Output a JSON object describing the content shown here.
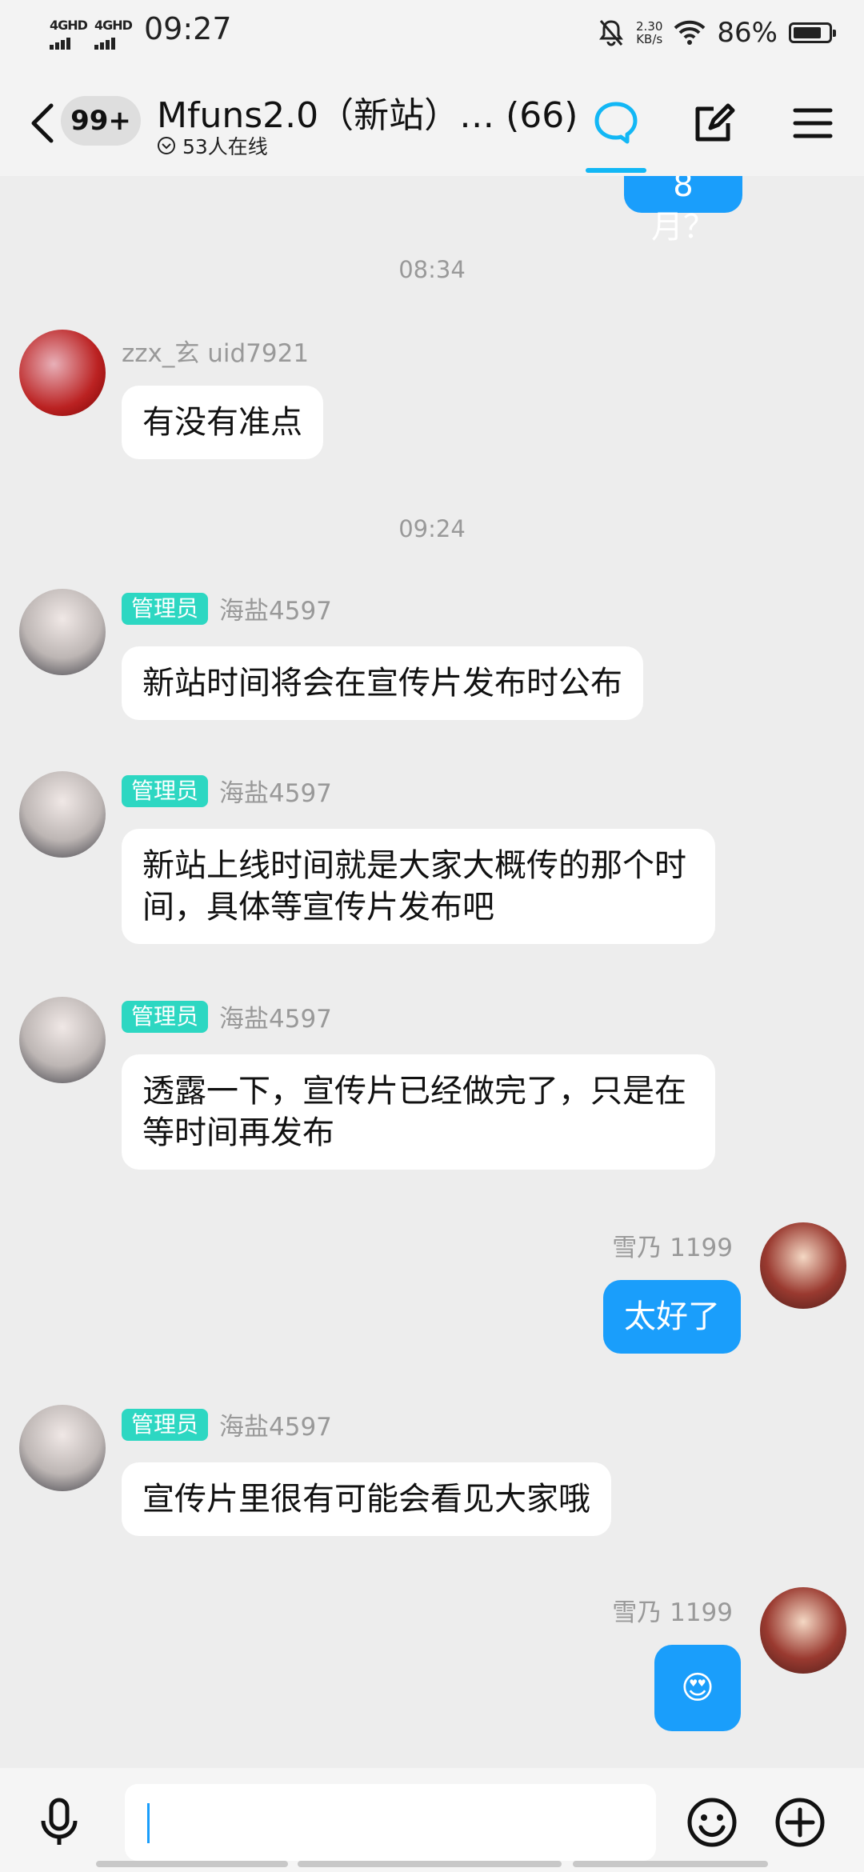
{
  "status_bar": {
    "sim1": "4GHD",
    "sim2": "4GHD",
    "time": "09:27",
    "net_speed_value": "2.30",
    "net_speed_unit": "KB/s",
    "battery_pct": "86%",
    "battery_level": 0.86
  },
  "header": {
    "unread_count": "99+",
    "title": "Mfuns2.0（新站）… (66)",
    "online": "53人在线",
    "accent_color": "#12b7f5"
  },
  "chat": {
    "top_partial_text": "8月？",
    "timestamps": [
      "08:34",
      "09:24"
    ],
    "messages": [
      {
        "sender": "zzx_玄 uid7921",
        "role": "",
        "text": "有没有准点",
        "outgoing": false
      },
      {
        "sender": "海盐4597",
        "role": "管理员",
        "text": "新站时间将会在宣传片发布时公布",
        "outgoing": false
      },
      {
        "sender": "海盐4597",
        "role": "管理员",
        "text": "新站上线时间就是大家大概传的那个时间，具体等宣传片发布吧",
        "outgoing": false
      },
      {
        "sender": "海盐4597",
        "role": "管理员",
        "text": "透露一下，宣传片已经做完了，只是在等时间再发布",
        "outgoing": false
      },
      {
        "sender": "雪乃 1199",
        "role": "",
        "text": "太好了",
        "outgoing": true
      },
      {
        "sender": "海盐4597",
        "role": "管理员",
        "text": "宣传片里很有可能会看见大家哦",
        "outgoing": false
      },
      {
        "sender": "雪乃 1199",
        "role": "",
        "text": "😍",
        "outgoing": true
      }
    ],
    "badge_color": "#2dd7c2",
    "outgoing_color": "#1a9efb"
  },
  "input": {
    "value": "",
    "placeholder": ""
  }
}
